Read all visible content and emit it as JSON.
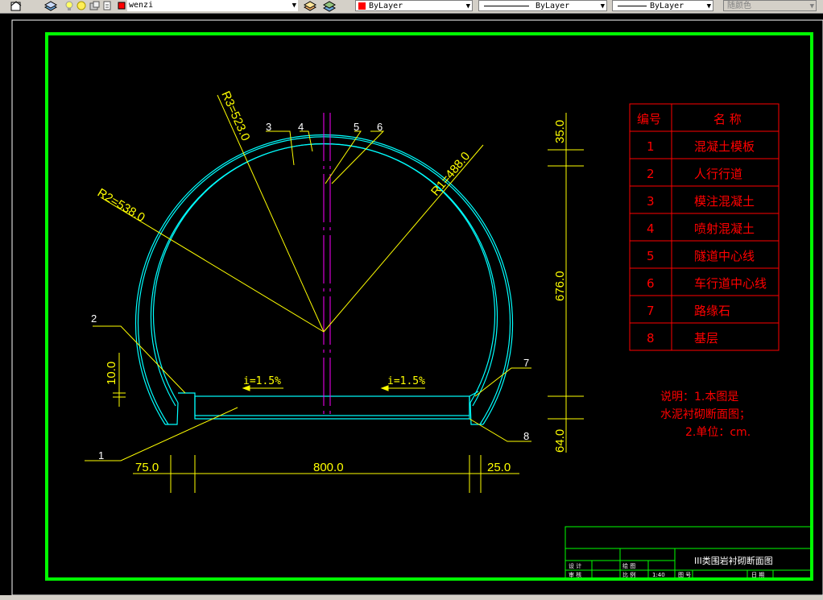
{
  "toolbar": {
    "layer_name": "wenzi",
    "layer_color": "#ff0000",
    "color_control": "ByLayer",
    "linetype_control": "ByLayer",
    "lineweight_control": "ByLayer",
    "plotstyle_control": "随颜色",
    "icons": [
      "layer-manager-icon",
      "lightbulb-icon",
      "sun-icon",
      "lock-icon",
      "layer-match-icon",
      "layer-previous-icon"
    ]
  },
  "drawing": {
    "colors": {
      "border": "#00ff00",
      "tunnel": "#00ffff",
      "dim": "#ffff00",
      "centerline": "#ff00ff",
      "table": "#ff0000"
    },
    "radius_labels": {
      "r1": "R1=488.0",
      "r2": "R2=538.0",
      "r3": "R3=523.0"
    },
    "callouts": [
      "1",
      "2",
      "3",
      "4",
      "5",
      "6",
      "7",
      "8"
    ],
    "slope_left": "i=1.5%",
    "slope_right": "i=1.5%",
    "dim_bottom": {
      "left": "75.0",
      "middle": "800.0",
      "right": "25.0"
    },
    "dim_right": {
      "top": "35.0",
      "middle": "676.0",
      "bottom": "64.0"
    },
    "dim_left_small": "10.0",
    "legend": {
      "header": {
        "no": "编号",
        "name": "名  称"
      },
      "rows": [
        {
          "no": "1",
          "name": "混凝土模板"
        },
        {
          "no": "2",
          "name": "人行行道"
        },
        {
          "no": "3",
          "name": "模注混凝土"
        },
        {
          "no": "4",
          "name": "喷射混凝土"
        },
        {
          "no": "5",
          "name": "隧道中心线"
        },
        {
          "no": "6",
          "name": "车行道中心线"
        },
        {
          "no": "7",
          "name": "路缘石"
        },
        {
          "no": "8",
          "name": "基层"
        }
      ]
    },
    "notes": [
      "说明：1.本图是",
      "水泥衬砌断面图；",
      "2.单位：cm."
    ],
    "title_block": {
      "title": "III类围岩衬砌断面图",
      "design": "设  计",
      "review": "审  核",
      "drawing_label": "绘  图",
      "scale_label": "比  例",
      "scale": "1:40",
      "sheet_label": "图  号",
      "date_label": "日  期"
    }
  }
}
